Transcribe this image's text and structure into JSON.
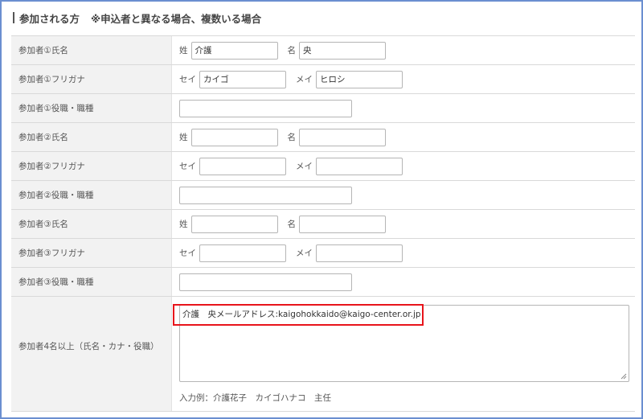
{
  "section": {
    "title": "参加される方",
    "note": "※申込者と異なる場合、複数いる場合"
  },
  "rows": {
    "p1_name": {
      "label": "参加者①氏名",
      "sei_label": "姓",
      "sei_value": "介護",
      "mei_label": "名",
      "mei_value": "央"
    },
    "p1_kana": {
      "label": "参加者①フリガナ",
      "sei_label": "セイ",
      "sei_value": "カイゴ",
      "mei_label": "メイ",
      "mei_value": "ヒロシ"
    },
    "p1_role": {
      "label": "参加者①役職・職種",
      "value": ""
    },
    "p2_name": {
      "label": "参加者②氏名",
      "sei_label": "姓",
      "sei_value": "",
      "mei_label": "名",
      "mei_value": ""
    },
    "p2_kana": {
      "label": "参加者②フリガナ",
      "sei_label": "セイ",
      "sei_value": "",
      "mei_label": "メイ",
      "mei_value": ""
    },
    "p2_role": {
      "label": "参加者②役職・職種",
      "value": ""
    },
    "p3_name": {
      "label": "参加者③氏名",
      "sei_label": "姓",
      "sei_value": "",
      "mei_label": "名",
      "mei_value": ""
    },
    "p3_kana": {
      "label": "参加者③フリガナ",
      "sei_label": "セイ",
      "sei_value": "",
      "mei_label": "メイ",
      "mei_value": ""
    },
    "p3_role": {
      "label": "参加者③役職・職種",
      "value": ""
    },
    "p4plus": {
      "label": "参加者4名以上（氏名・カナ・役職）",
      "value": "介護　央メールアドレス:kaigohokkaido@kaigo-center.or.jp",
      "example": "入力例：介護花子　カイゴハナコ　主任"
    }
  },
  "colors": {
    "frame": "#6b8fd0",
    "highlight": "#e8141b",
    "label_bg": "#f2f2f2",
    "border": "#d9d9d9"
  }
}
